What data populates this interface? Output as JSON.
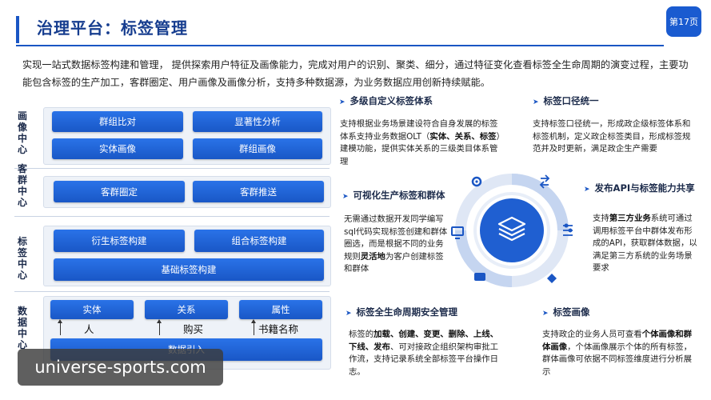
{
  "header": {
    "title": "治理平台：标签管理",
    "page_badge": "第17页"
  },
  "intro": "实现一站式数据标签构建和管理，  提供探索用户特征及画像能力，完成对用户的识别、聚类、细分，通过特征变化查看标签全生命周期的演变过程，主要功能包含标签的生产加工，客群圈定、用户画像及画像分析，支持多种数据源，为业务数据应用创新持续赋能。",
  "architecture": {
    "sections": [
      {
        "label": "画像中心",
        "buttons": [
          "群组比对",
          "显著性分析",
          "实体画像",
          "群组画像"
        ]
      },
      {
        "label": "客群中心",
        "buttons": [
          "客群圈定",
          "客群推送"
        ]
      },
      {
        "label": "标签中心",
        "buttons": [
          "衍生标签构建",
          "组合标签构建",
          "基础标签构建"
        ]
      },
      {
        "label": "数据中心",
        "buttons": [
          "实体",
          "关系",
          "属性",
          "数据引入"
        ],
        "entities": [
          "人",
          "购买",
          "书籍名称"
        ]
      }
    ]
  },
  "features": {
    "f1": {
      "title": "多级自定义标签体系",
      "desc": [
        "支持根据业务场景建设符合自身发展的标签体系支持业务数据OLT（",
        "实体、关系、标签",
        "）建模功能，提供实体关系的三级类目体系管理"
      ]
    },
    "f2": {
      "title": "标签口径统一",
      "desc": "支持标签口径统一，形成政企级标签体系和标签机制，定义政企标签类目，形成标签规范并及时更新，满足政企生产需要"
    },
    "f3": {
      "title": "可视化生产标签和群体",
      "desc": [
        "无需通过数据开发同学编写sql代码实现标签创建和群体圈选，而是根据不同的业务规则",
        "灵活地",
        "为客户创建标签和群体"
      ]
    },
    "f4": {
      "title": "发布API与标签能力共享",
      "desc": [
        "支持",
        "第三方业务",
        "系统可通过调用标签平台中群体发布形成的API，获取群体数据，以满足第三方系统的业务场景要求"
      ]
    },
    "f5": {
      "title": "标签全生命周期安全管理",
      "desc": [
        "标签的",
        "加载、创建、变更、删除、上线、下线、发布",
        "、可对接政企组织架构审批工作流，支持记录系统全部标签平台操作日志。"
      ]
    },
    "f6": {
      "title": "标签画像",
      "desc": [
        "支持政企的业务人员可查看",
        "个体画像和群体画像",
        "，个体画像展示个体的所有标签，群体画像可依据不同标签维度进行分析展示"
      ]
    }
  },
  "watermark": "universe-sports.com",
  "icons": [
    "gear-icon",
    "swap-icon",
    "sliders-icon",
    "diamond-icon",
    "database-icon",
    "monitor-icon",
    "layers-icon"
  ],
  "colors": {
    "primary": "#1a56c4",
    "button": "#2266dd",
    "panel": "#eef2f8"
  }
}
